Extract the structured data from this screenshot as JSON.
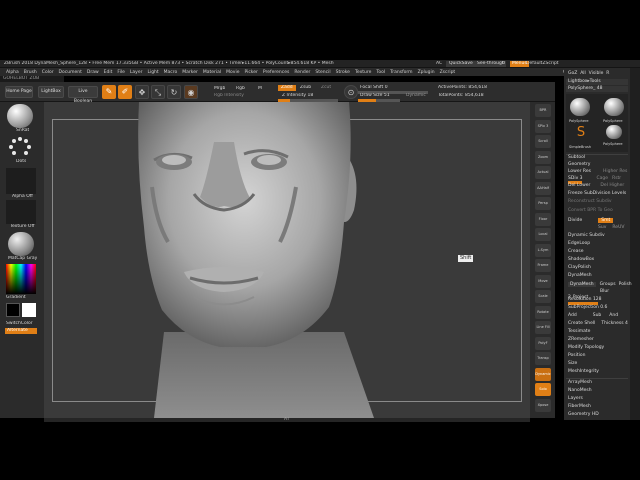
{
  "title_bar": {
    "text": "ZBrush 2018   DynaMesh_Sphere_128   • Free Mem 17.335GB • Active Mem 873 • Scratch Disk 271 • Timer▸11.664 • PolyCount▸854.618 KP • MeshCount▸1",
    "ac": "AC",
    "quicksave": "QuickSave",
    "seethrough_label": "See-through",
    "seethrough_value": "0",
    "menus": "Menus",
    "defaultzscript": "DefaultZScript"
  },
  "menu_bar": [
    "Alpha",
    "Brush",
    "Color",
    "Document",
    "Draw",
    "Edit",
    "File",
    "Layer",
    "Light",
    "Macro",
    "Marker",
    "Material",
    "Movie",
    "Picker",
    "Preferences",
    "Render",
    "Stencil",
    "Stroke",
    "Texture",
    "Tool",
    "Transform",
    "Zplugin",
    "Zscript"
  ],
  "right_menu": [
    "Close",
    "Make PolyMesh3D"
  ],
  "hint": "GOHELBOT ZOB",
  "toolbar": {
    "home_page": "Home Page",
    "lightbox": "LightBox",
    "live_boolean": "Live Boolean",
    "edit": "Edit",
    "draw": "Draw",
    "move": "Move",
    "scale": "Scale",
    "rotate": "Rotate",
    "mrgb": "Mrgb",
    "rgb": "Rgb",
    "m": "M",
    "rgb_intensity": "Rgb Intensity",
    "zadd": "Zadd",
    "zsub": "Zsub",
    "zcut": "Zcut",
    "z_intensity": "Z Intensity 18",
    "focal_shift": "Focal Shift 0",
    "draw_size": "Draw Size 51",
    "dynamic": "Dynamic",
    "active_points": "ActivePoints: 854,618",
    "total_points": "TotalPoints: 854,618"
  },
  "left_panel": {
    "brush_label": "SnRat",
    "stroke_label": "Dots",
    "alpha_label": "Alpha Off",
    "texture_label": "Texture Off",
    "material_label": "MatCap Gray",
    "gradient": "Gradient",
    "switch_color": "SwitchColor",
    "alternate": "Alternate"
  },
  "viewport": {
    "shift_label": "Shift",
    "bottom_hint": "AT"
  },
  "right_icons": [
    "BPR",
    "SPix 3",
    "Scroll",
    "Zoom",
    "Actual",
    "AAHalf",
    "Persp",
    "Floor",
    "Local",
    "L.Sym",
    "Frame",
    "Move",
    "Scale",
    "Rotate",
    "Line Fill",
    "PolyF",
    "Transp",
    "Dynamic",
    "Solo",
    "Xpose"
  ],
  "tool_panel": {
    "close": "Close",
    "make_polymesh": "Make PolyMesh3D",
    "goz": "GoZ",
    "all": "All",
    "visible": "Visible",
    "r": "R",
    "lightbox_tools": "Lightbox▸Tools",
    "polysphere_count": "PolySphere_  48",
    "tool_thumbs": [
      "PolySphere",
      "PolySphere",
      "PolySphere",
      "SimpleBrush"
    ],
    "subtool": "Subtool",
    "geometry": "Geometry",
    "lower_res": "Lower Res",
    "higher_res": "Higher Res",
    "sdiv": "SDiv 3",
    "cage": "Cage",
    "rstr": "Rstr",
    "del_lower": "Del Lower",
    "del_higher": "Del Higher",
    "freeze_subdiv": "Freeze SubDivision Levels",
    "reconstruct_subdiv": "Reconstruct Subdiv",
    "convert_bpr": "Convert BPR To Geo",
    "divide": "Divide",
    "smt": "Smt",
    "suv": "Suv",
    "reuv": "ReUV",
    "dynamic_subdiv": "Dynamic Subdiv",
    "edge_loop": "EdgeLoop",
    "crease": "Crease",
    "shadow_box": "ShadowBox",
    "clay_polish": "ClayPolish",
    "dynamesh": "DynaMesh",
    "dynamesh_btn": "DynaMesh",
    "groups": "Groups",
    "polish": "Polish",
    "blur": "Blur 2",
    "project": "Project",
    "resolution": "Resolution 128",
    "subprojection": "SubProjection 0.6",
    "add": "Add",
    "sub": "Sub",
    "and": "And",
    "create_shell": "Create Shell",
    "thickness": "Thickness 4",
    "tessimate": "Tessimate",
    "zremesher": "ZRemesher",
    "modify_topology": "Modify Topology",
    "position": "Position",
    "size": "Size",
    "mesh_integrity": "MeshIntegrity",
    "array_mesh": "ArrayMesh",
    "nano_mesh": "NanoMesh",
    "layers": "Layers",
    "fiber_mesh": "FiberMesh",
    "geometry_hd": "Geometry HD"
  },
  "colors": {
    "accent": "#e07f16",
    "panel": "#2b2b2b",
    "viewport": "#3a3a3a"
  }
}
